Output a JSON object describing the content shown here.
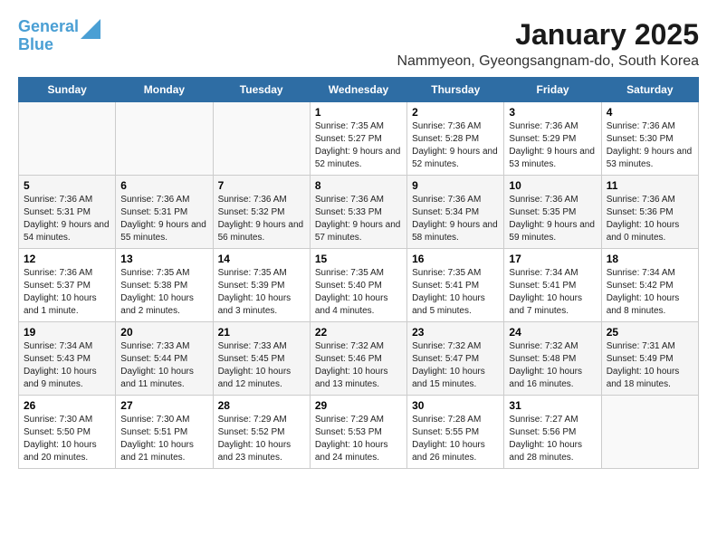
{
  "header": {
    "logo_line1": "General",
    "logo_line2": "Blue",
    "title": "January 2025",
    "subtitle": "Nammyeon, Gyeongsangnam-do, South Korea"
  },
  "weekdays": [
    "Sunday",
    "Monday",
    "Tuesday",
    "Wednesday",
    "Thursday",
    "Friday",
    "Saturday"
  ],
  "weeks": [
    [
      {
        "day": "",
        "info": ""
      },
      {
        "day": "",
        "info": ""
      },
      {
        "day": "",
        "info": ""
      },
      {
        "day": "1",
        "info": "Sunrise: 7:35 AM\nSunset: 5:27 PM\nDaylight: 9 hours and 52 minutes."
      },
      {
        "day": "2",
        "info": "Sunrise: 7:36 AM\nSunset: 5:28 PM\nDaylight: 9 hours and 52 minutes."
      },
      {
        "day": "3",
        "info": "Sunrise: 7:36 AM\nSunset: 5:29 PM\nDaylight: 9 hours and 53 minutes."
      },
      {
        "day": "4",
        "info": "Sunrise: 7:36 AM\nSunset: 5:30 PM\nDaylight: 9 hours and 53 minutes."
      }
    ],
    [
      {
        "day": "5",
        "info": "Sunrise: 7:36 AM\nSunset: 5:31 PM\nDaylight: 9 hours and 54 minutes."
      },
      {
        "day": "6",
        "info": "Sunrise: 7:36 AM\nSunset: 5:31 PM\nDaylight: 9 hours and 55 minutes."
      },
      {
        "day": "7",
        "info": "Sunrise: 7:36 AM\nSunset: 5:32 PM\nDaylight: 9 hours and 56 minutes."
      },
      {
        "day": "8",
        "info": "Sunrise: 7:36 AM\nSunset: 5:33 PM\nDaylight: 9 hours and 57 minutes."
      },
      {
        "day": "9",
        "info": "Sunrise: 7:36 AM\nSunset: 5:34 PM\nDaylight: 9 hours and 58 minutes."
      },
      {
        "day": "10",
        "info": "Sunrise: 7:36 AM\nSunset: 5:35 PM\nDaylight: 9 hours and 59 minutes."
      },
      {
        "day": "11",
        "info": "Sunrise: 7:36 AM\nSunset: 5:36 PM\nDaylight: 10 hours and 0 minutes."
      }
    ],
    [
      {
        "day": "12",
        "info": "Sunrise: 7:36 AM\nSunset: 5:37 PM\nDaylight: 10 hours and 1 minute."
      },
      {
        "day": "13",
        "info": "Sunrise: 7:35 AM\nSunset: 5:38 PM\nDaylight: 10 hours and 2 minutes."
      },
      {
        "day": "14",
        "info": "Sunrise: 7:35 AM\nSunset: 5:39 PM\nDaylight: 10 hours and 3 minutes."
      },
      {
        "day": "15",
        "info": "Sunrise: 7:35 AM\nSunset: 5:40 PM\nDaylight: 10 hours and 4 minutes."
      },
      {
        "day": "16",
        "info": "Sunrise: 7:35 AM\nSunset: 5:41 PM\nDaylight: 10 hours and 5 minutes."
      },
      {
        "day": "17",
        "info": "Sunrise: 7:34 AM\nSunset: 5:41 PM\nDaylight: 10 hours and 7 minutes."
      },
      {
        "day": "18",
        "info": "Sunrise: 7:34 AM\nSunset: 5:42 PM\nDaylight: 10 hours and 8 minutes."
      }
    ],
    [
      {
        "day": "19",
        "info": "Sunrise: 7:34 AM\nSunset: 5:43 PM\nDaylight: 10 hours and 9 minutes."
      },
      {
        "day": "20",
        "info": "Sunrise: 7:33 AM\nSunset: 5:44 PM\nDaylight: 10 hours and 11 minutes."
      },
      {
        "day": "21",
        "info": "Sunrise: 7:33 AM\nSunset: 5:45 PM\nDaylight: 10 hours and 12 minutes."
      },
      {
        "day": "22",
        "info": "Sunrise: 7:32 AM\nSunset: 5:46 PM\nDaylight: 10 hours and 13 minutes."
      },
      {
        "day": "23",
        "info": "Sunrise: 7:32 AM\nSunset: 5:47 PM\nDaylight: 10 hours and 15 minutes."
      },
      {
        "day": "24",
        "info": "Sunrise: 7:32 AM\nSunset: 5:48 PM\nDaylight: 10 hours and 16 minutes."
      },
      {
        "day": "25",
        "info": "Sunrise: 7:31 AM\nSunset: 5:49 PM\nDaylight: 10 hours and 18 minutes."
      }
    ],
    [
      {
        "day": "26",
        "info": "Sunrise: 7:30 AM\nSunset: 5:50 PM\nDaylight: 10 hours and 20 minutes."
      },
      {
        "day": "27",
        "info": "Sunrise: 7:30 AM\nSunset: 5:51 PM\nDaylight: 10 hours and 21 minutes."
      },
      {
        "day": "28",
        "info": "Sunrise: 7:29 AM\nSunset: 5:52 PM\nDaylight: 10 hours and 23 minutes."
      },
      {
        "day": "29",
        "info": "Sunrise: 7:29 AM\nSunset: 5:53 PM\nDaylight: 10 hours and 24 minutes."
      },
      {
        "day": "30",
        "info": "Sunrise: 7:28 AM\nSunset: 5:55 PM\nDaylight: 10 hours and 26 minutes."
      },
      {
        "day": "31",
        "info": "Sunrise: 7:27 AM\nSunset: 5:56 PM\nDaylight: 10 hours and 28 minutes."
      },
      {
        "day": "",
        "info": ""
      }
    ]
  ]
}
